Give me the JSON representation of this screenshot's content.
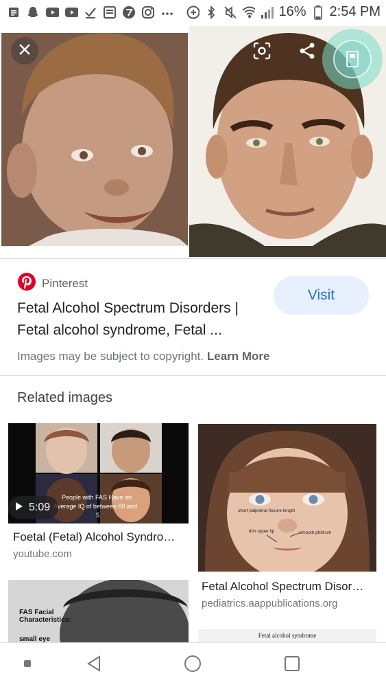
{
  "status_bar": {
    "battery": "16%",
    "time": "2:54 PM",
    "left_icons": [
      "notes-icon",
      "snapchat-icon",
      "youtube-icon",
      "youtube-icon",
      "checkmark-icon",
      "news-icon",
      "seven-icon",
      "instagram-icon",
      "more-dots-icon"
    ],
    "right_icons": [
      "data-saver-icon",
      "bluetooth-icon",
      "mute-icon",
      "wifi-icon",
      "signal-icon",
      "battery-icon"
    ]
  },
  "viewer": {
    "close_icon": "close-icon",
    "lens_icon": "google-lens-icon",
    "share_icon": "share-icon",
    "floating_icon": "floating-bubble-icon"
  },
  "source": {
    "name": "Pinterest",
    "icon": "pinterest-icon",
    "brand_color": "#e60023"
  },
  "result": {
    "title": "Fetal Alcohol Spectrum Disorders | Fetal alcohol syndrome, Fetal ...",
    "visit_label": "Visit",
    "copyright_text": "Images may be subject to copyright.",
    "learn_more_label": "Learn More"
  },
  "related": {
    "heading": "Related images",
    "items": [
      {
        "title": "Foetal (Fetal) Alcohol Syndro…",
        "source": "youtube.com",
        "duration": "5:09",
        "overlay_text": [
          "People with FAS Have an",
          "Average IQ of between 60 and",
          "5"
        ]
      },
      {
        "title": "Fetal Alcohol Spectrum Disor…",
        "source": "pediatrics.aappublications.org",
        "labels": [
          "short palpebral fissure length",
          "thin upper lip",
          "smooth philtrum"
        ]
      },
      {
        "caption_lines": [
          "FAS Facial",
          "Characteristics:",
          "small eye"
        ]
      },
      {
        "caption": "Fetal alcohol syndrome"
      }
    ]
  },
  "nav": {
    "icons": [
      "recents-dot-icon",
      "back-icon",
      "home-icon",
      "overview-icon"
    ]
  },
  "colors": {
    "accent_blue": "#1a73e8",
    "visit_bg": "#e8f0fe"
  }
}
